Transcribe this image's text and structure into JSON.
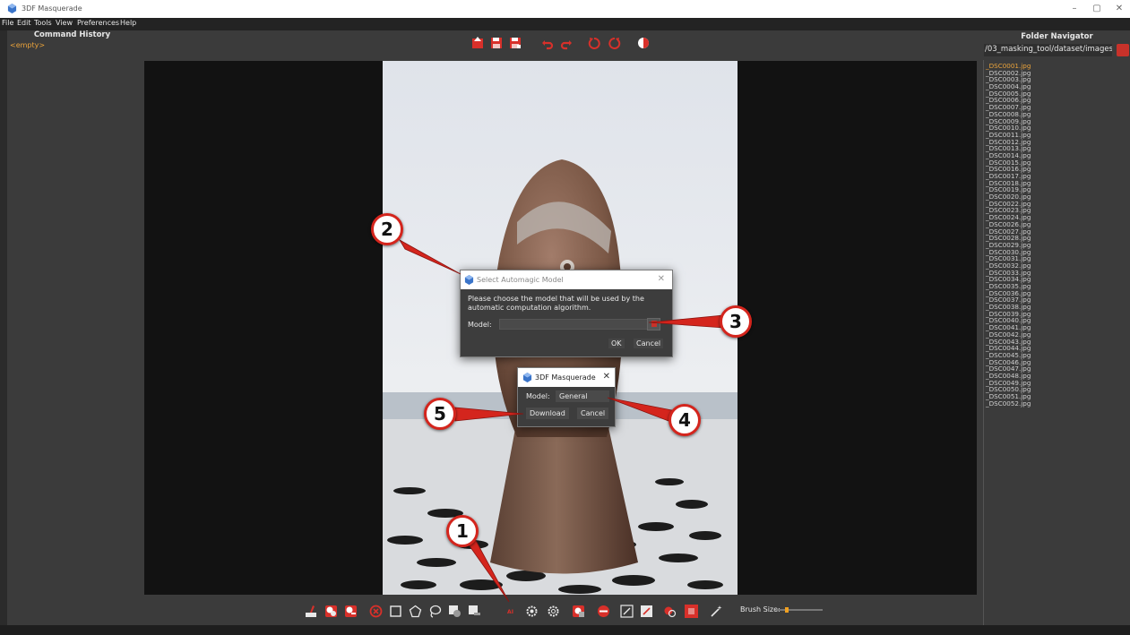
{
  "window": {
    "title": "3DF Masquerade",
    "minimize": "–",
    "maximize": "▢",
    "close": "✕"
  },
  "menu": [
    "File",
    "Edit",
    "Tools",
    "View",
    "Preferences",
    "Help"
  ],
  "command_history": {
    "title": "Command History",
    "empty_label": "<empty>"
  },
  "folder_navigator": {
    "title": "Folder Navigator",
    "path": "/03_masking_tool/dataset/images",
    "files": [
      "_DSC0001.jpg",
      "_DSC0002.jpg",
      "_DSC0003.jpg",
      "_DSC0004.jpg",
      "_DSC0005.jpg",
      "_DSC0006.jpg",
      "_DSC0007.jpg",
      "_DSC0008.jpg",
      "_DSC0009.jpg",
      "_DSC0010.jpg",
      "_DSC0011.jpg",
      "_DSC0012.jpg",
      "_DSC0013.jpg",
      "_DSC0014.jpg",
      "_DSC0015.jpg",
      "_DSC0016.jpg",
      "_DSC0017.jpg",
      "_DSC0018.jpg",
      "_DSC0019.jpg",
      "_DSC0020.jpg",
      "_DSC0022.jpg",
      "_DSC0023.jpg",
      "_DSC0024.jpg",
      "_DSC0026.jpg",
      "_DSC0027.jpg",
      "_DSC0028.jpg",
      "_DSC0029.jpg",
      "_DSC0030.jpg",
      "_DSC0031.jpg",
      "_DSC0032.jpg",
      "_DSC0033.jpg",
      "_DSC0034.jpg",
      "_DSC0035.jpg",
      "_DSC0036.jpg",
      "_DSC0037.jpg",
      "_DSC0038.jpg",
      "_DSC0039.jpg",
      "_DSC0040.jpg",
      "_DSC0041.jpg",
      "_DSC0042.jpg",
      "_DSC0043.jpg",
      "_DSC0044.jpg",
      "_DSC0045.jpg",
      "_DSC0046.jpg",
      "_DSC0047.jpg",
      "_DSC0048.jpg",
      "_DSC0049.jpg",
      "_DSC0050.jpg",
      "_DSC0051.jpg",
      "_DSC0052.jpg"
    ],
    "selected_index": 0
  },
  "automagic_dialog": {
    "title": "Select Automagic Model",
    "close": "✕",
    "description": "Please choose the model that will be used by the automatic computation algorithm.",
    "model_label": "Model:",
    "ok_label": "OK",
    "cancel_label": "Cancel"
  },
  "download_dialog": {
    "title": "3DF Masquerade",
    "close": "✕",
    "model_label": "Model:",
    "model_value": "General",
    "download_label": "Download",
    "cancel_label": "Cancel"
  },
  "callouts": [
    "1",
    "2",
    "3",
    "4",
    "5"
  ],
  "bottom_toolbar": {
    "brush_size_label": "Brush Size:",
    "brush_size_fraction": 0.2
  },
  "colors": {
    "accent_red": "#c8322a",
    "highlight_orange": "#e9a23b",
    "panel_bg": "#3b3b3b"
  }
}
